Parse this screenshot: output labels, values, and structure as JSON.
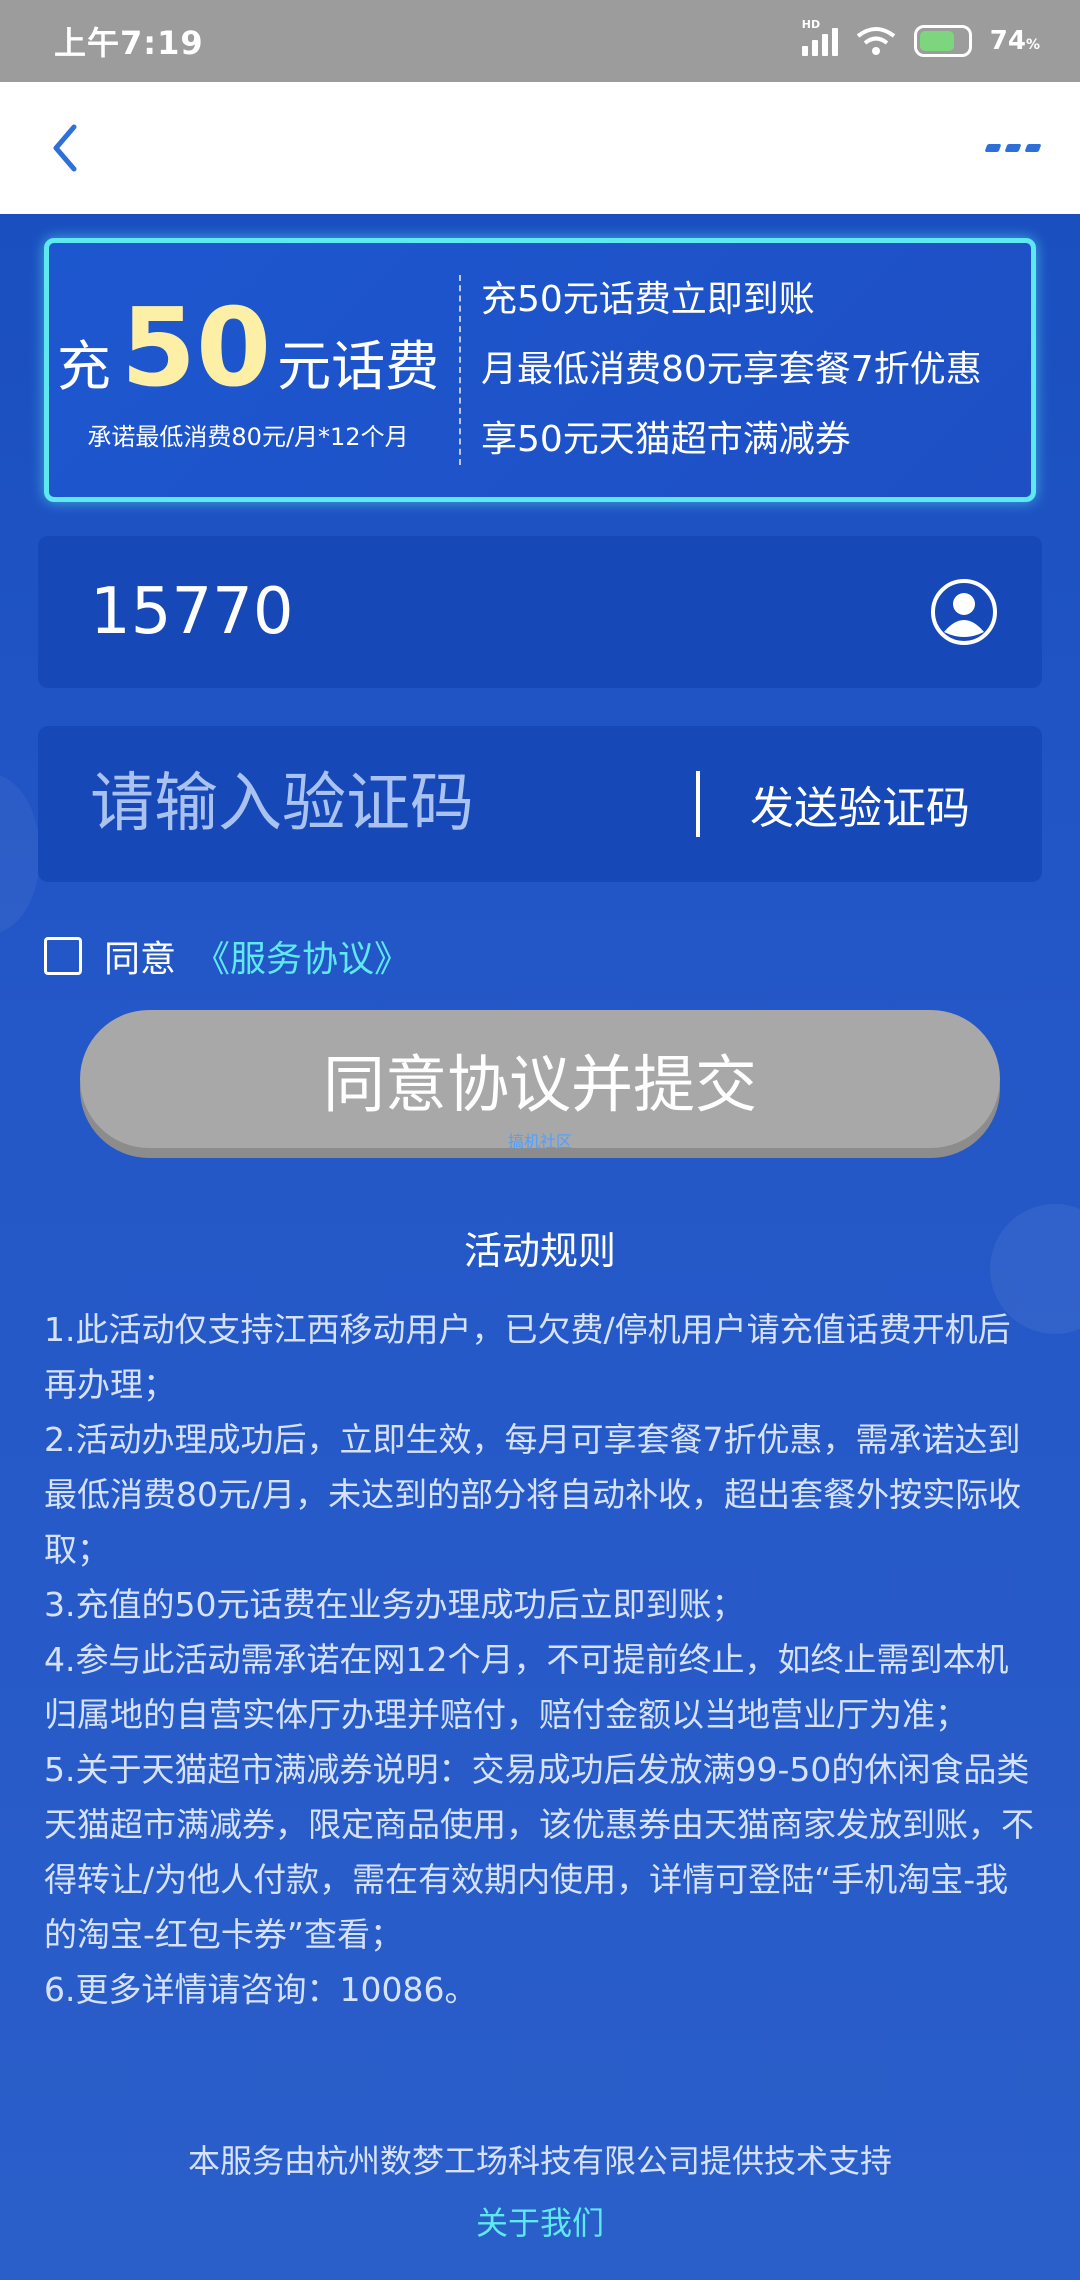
{
  "status_bar": {
    "time": "上午7:19",
    "signal_label": "HD",
    "battery_percent": "74",
    "battery_unit": "%"
  },
  "nav": {
    "back_icon": "chevron-left-icon",
    "more_icon": "more-dots-icon",
    "accent_color": "#2f6fd9"
  },
  "banner": {
    "headline_pre": "充",
    "headline_amount": "50",
    "headline_post": "元话费",
    "sub": "承诺最低消费80元/月*12个月",
    "benefits": [
      "充50元话费立即到账",
      "月最低消费80元享套餐7折优惠",
      "享50元天猫超市满减券"
    ]
  },
  "form": {
    "phone_value": "15770",
    "contact_icon": "user-avatar-icon",
    "code_placeholder": "请输入验证码",
    "send_code_label": "发送验证码",
    "agree_label": "同意",
    "agree_link": "《服务协议》",
    "submit_label": "同意协议并提交"
  },
  "watermark": "搞机社区",
  "rules": {
    "title": "活动规则",
    "items": [
      "1.此活动仅支持江西移动用户，已欠费/停机用户请充值话费开机后再办理；",
      "2.活动办理成功后，立即生效，每月可享套餐7折优惠，需承诺达到最低消费80元/月，未达到的部分将自动补收，超出套餐外按实际收取；",
      "3.充值的50元话费在业务办理成功后立即到账；",
      "4.参与此活动需承诺在网12个月，不可提前终止，如终止需到本机归属地的自营实体厅办理并赔付，赔付金额以当地营业厅为准；",
      "5.关于天猫超市满减券说明：交易成功后发放满99-50的休闲食品类天猫超市满减券，限定商品使用，该优惠券由天猫商家发放到账，不得转让/为他人付款，需在有效期内使用，详情可登陆“手机淘宝-我的淘宝-红包卡券”查看；",
      "6.更多详情请咨询：10086。"
    ]
  },
  "footer": {
    "text": "本服务由杭州数梦工场科技有限公司提供技术支持",
    "link": "关于我们"
  },
  "colors": {
    "background": "#2157c9",
    "banner_border": "#5ee8f0",
    "highlight": "#fdf0a6",
    "submit_disabled": "#a8a8a8"
  }
}
